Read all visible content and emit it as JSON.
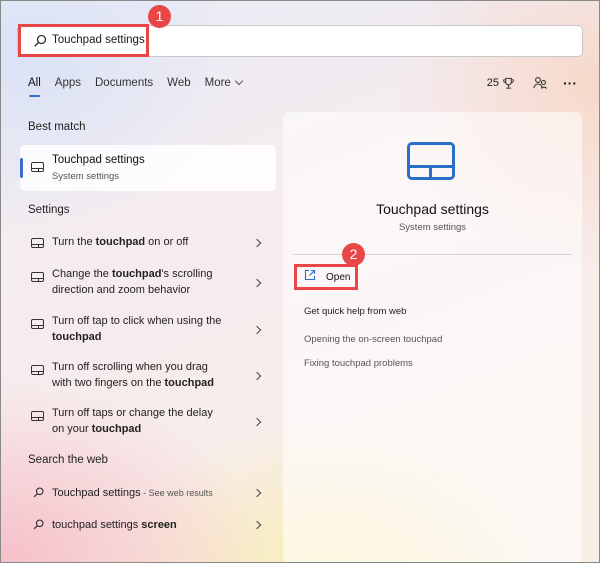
{
  "search": {
    "query": "Touchpad settings"
  },
  "tabs": [
    {
      "label": "All"
    },
    {
      "label": "Apps"
    },
    {
      "label": "Documents"
    },
    {
      "label": "Web"
    },
    {
      "label": "More"
    }
  ],
  "header_right": {
    "points": "25",
    "trophy_icon": "trophy-icon",
    "people_icon": "people-icon",
    "more_icon": "more-options-icon"
  },
  "best_match": {
    "section_title": "Best match",
    "title": "Touchpad settings",
    "subtitle": "System settings",
    "icon": "touchpad-icon"
  },
  "settings": {
    "section_title": "Settings",
    "items": [
      {
        "line1a": "Turn the ",
        "line1b": "touchpad",
        "line1c": " on or off"
      },
      {
        "line1a": "Change the ",
        "line1b": "touchpad",
        "line1c": "'s scrolling",
        "line2": "direction and zoom behavior"
      },
      {
        "line1a": "Turn off tap to click when using the",
        "line2b": "touchpad"
      },
      {
        "line1a": "Turn off scrolling when you drag",
        "line2a": "with two fingers on the ",
        "line2b": "touchpad"
      },
      {
        "line1a": "Turn off taps or change the delay",
        "line2a": "on your ",
        "line2b": "touchpad"
      }
    ]
  },
  "web": {
    "section_title": "Search the web",
    "items": [
      {
        "text": "Touchpad settings",
        "suffix": " - See web results"
      },
      {
        "text": "touchpad settings ",
        "bold": "screen"
      }
    ]
  },
  "preview": {
    "title": "Touchpad settings",
    "subtitle": "System settings",
    "open_label": "Open",
    "help_title": "Get quick help from web",
    "links": [
      "Opening the on-screen touchpad",
      "Fixing touchpad problems"
    ]
  },
  "callouts": [
    "1",
    "2"
  ],
  "colors": {
    "accent": "#3a6fd1",
    "callout": "#e94747",
    "icon_blue": "#2a6fc7"
  }
}
